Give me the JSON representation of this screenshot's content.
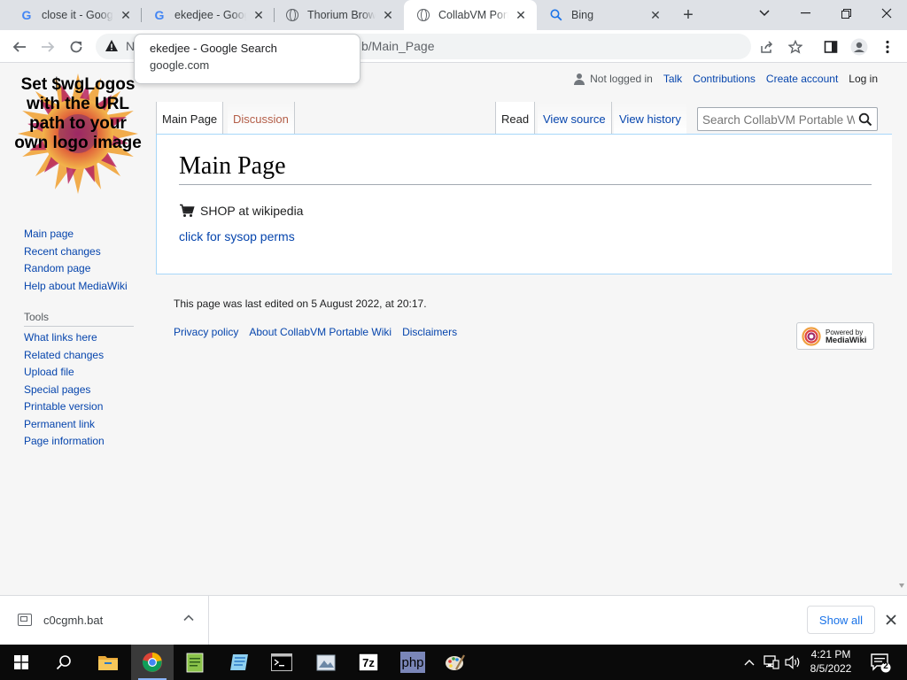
{
  "browser": {
    "tabs": [
      {
        "title": "close it - Google Search",
        "favicon": "google-g-icon"
      },
      {
        "title": "ekedjee - Google Search",
        "favicon": "google-g-icon"
      },
      {
        "title": "Thorium Browser",
        "favicon": "globe-icon"
      },
      {
        "title": "CollabVM Portable Wiki",
        "favicon": "globe-icon",
        "active": true
      },
      {
        "title": "Bing",
        "favicon": "search-icon"
      }
    ],
    "omnibox": {
      "security_prefix": "N",
      "url_tail": "b/Main_Page"
    },
    "tab_hover_card": {
      "title": "ekedjee - Google Search",
      "domain": "google.com"
    }
  },
  "wiki": {
    "logo_text": "Set $wgLogos with the URL path to your own logo image",
    "user_nav": {
      "status": "Not logged in",
      "links": [
        "Talk",
        "Contributions",
        "Create account",
        "Log in"
      ]
    },
    "namespace_tabs": [
      "Main Page",
      "Discussion"
    ],
    "view_tabs": [
      "Read",
      "View source",
      "View history"
    ],
    "search": {
      "placeholder": "Search CollabVM Portable Wiki"
    },
    "page": {
      "title": "Main Page",
      "shop_text": "SHOP at wikipedia",
      "sysop_link": "click for sysop perms"
    },
    "navigation": [
      "Main page",
      "Recent changes",
      "Random page",
      "Help about MediaWiki"
    ],
    "tools": {
      "heading": "Tools",
      "items": [
        "What links here",
        "Related changes",
        "Upload file",
        "Special pages",
        "Printable version",
        "Permanent link",
        "Page information"
      ]
    },
    "footer": {
      "last_edited": "This page was last edited on 5 August 2022, at 20:17.",
      "links": [
        "Privacy policy",
        "About CollabVM Portable Wiki",
        "Disclaimers"
      ],
      "powered_by_line1": "Powered by",
      "powered_by_line2": "MediaWiki"
    }
  },
  "download_bar": {
    "file_name": "c0cgmh.bat",
    "show_all": "Show all"
  },
  "taskbar": {
    "time": "4:21 PM",
    "date": "8/5/2022",
    "notification_count": "2",
    "apps": [
      "file-explorer-icon",
      "chrome-icon",
      "notepad-plus-icon",
      "wordpad-icon",
      "cmd-icon",
      "image-editor-icon",
      "7zip-icon",
      "php-icon",
      "paint-icon"
    ]
  },
  "colors": {
    "link": "#0645ad",
    "new_link": "#b35d47",
    "tabstrip": "#dee1e6",
    "taskbar": "#0a0a0a"
  }
}
